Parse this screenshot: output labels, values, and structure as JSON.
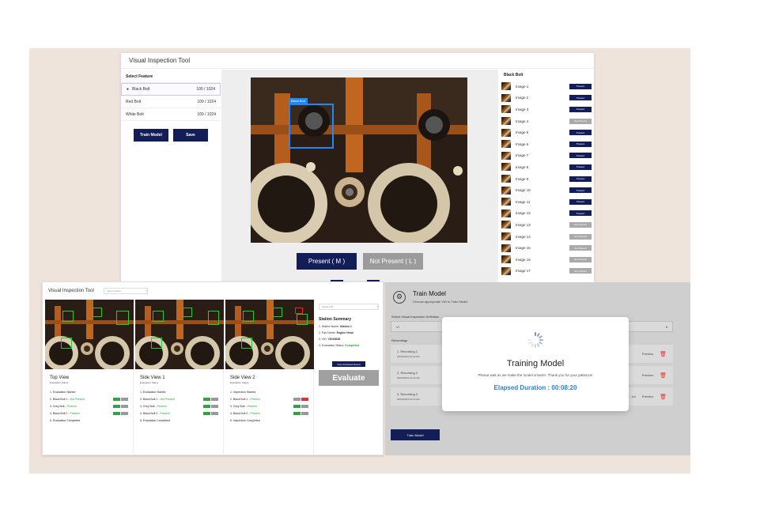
{
  "main": {
    "title": "Visual Inspection Tool",
    "features_header": "Select Feature",
    "features": [
      {
        "name": "Black Bolt",
        "count": "100 / 1024",
        "selected": true
      },
      {
        "name": "Red Bolt",
        "count": "100 / 1024"
      },
      {
        "name": "White Bolt",
        "count": "100 / 1024"
      }
    ],
    "train_label": "Train Model",
    "save_label": "Save",
    "bbox_tag": "Black Bolt",
    "present_label": "Present ( M )",
    "not_present_label": "Not Present ( L )",
    "images_header": "Black Bolt",
    "images": [
      {
        "name": "Image 1",
        "tag": "Present"
      },
      {
        "name": "Image 2",
        "tag": "Present"
      },
      {
        "name": "Image 3",
        "tag": "Present"
      },
      {
        "name": "Image 4",
        "tag": "Not Present"
      },
      {
        "name": "Image 5",
        "tag": "Present"
      },
      {
        "name": "Image 6",
        "tag": "Present"
      },
      {
        "name": "Image 7",
        "tag": "Present"
      },
      {
        "name": "Image 8",
        "tag": "Present"
      },
      {
        "name": "Image 9",
        "tag": "Present"
      },
      {
        "name": "Image 10",
        "tag": "Present"
      },
      {
        "name": "Image 11",
        "tag": "Present"
      },
      {
        "name": "Image 12",
        "tag": "Present"
      },
      {
        "name": "Image 13",
        "tag": "Not Present"
      },
      {
        "name": "Image 14",
        "tag": "Not Present"
      },
      {
        "name": "Image 15",
        "tag": "Not Present"
      },
      {
        "name": "Image 16",
        "tag": "Not Present"
      },
      {
        "name": "Image 17",
        "tag": "Not Present"
      }
    ]
  },
  "evaluation": {
    "title": "Visual Inspection Tool",
    "station_select": "Select Station",
    "views": [
      {
        "title": "Top View",
        "subtitle": "Evaluation Status",
        "rows": [
          {
            "text": "1. Evaluation Started"
          },
          {
            "text": "2. Black Bolt 1 - ",
            "status": "Not Present",
            "marks": [
              "g",
              "gr"
            ]
          },
          {
            "text": "3. Grey Bolt - ",
            "status": "Present",
            "marks": [
              "g",
              "gr"
            ]
          },
          {
            "text": "4. Black Bolt 2 - ",
            "status": "Present",
            "marks": [
              "g",
              "gr"
            ]
          },
          {
            "text": "5. Evaluation Completed"
          }
        ]
      },
      {
        "title": "Side View 1",
        "subtitle": "Evaluation Status",
        "rows": [
          {
            "text": "1. Evaluation Started"
          },
          {
            "text": "2. Black Bolt 1 - ",
            "status": "Not Present",
            "marks": [
              "g",
              "gr"
            ]
          },
          {
            "text": "3. Grey Bolt - ",
            "status": "Present",
            "marks": [
              "g",
              "gr"
            ]
          },
          {
            "text": "4. Black Bolt 2 - ",
            "status": "Present",
            "marks": [
              "g",
              "gr"
            ]
          },
          {
            "text": "5. Evaluation Completed"
          }
        ]
      },
      {
        "title": "Side View 2",
        "subtitle": "Evaluation Status",
        "rows": [
          {
            "text": "1. Inspection Started"
          },
          {
            "text": "2. Black Bolt 1 - ",
            "status": "Present",
            "marks": [
              "gr",
              "r"
            ]
          },
          {
            "text": "3. Grey Bolt - ",
            "status": "Present",
            "marks": [
              "g",
              "gr"
            ]
          },
          {
            "text": "4. Black Bolt 2 - ",
            "status": "Present",
            "marks": [
              "g",
              "gr"
            ]
          },
          {
            "text": "5. Inspection Completed"
          }
        ]
      }
    ],
    "summary_select": "Select VID",
    "summary_title": "Station Summary",
    "summary": [
      {
        "label": "1. Station Name: ",
        "value": "Station 1"
      },
      {
        "label": "2. Part Name: ",
        "value": "Engine Head"
      },
      {
        "label": "3. VID: ",
        "value": "VID45838"
      },
      {
        "label": "4. Evaluation Status: ",
        "value": "Completed",
        "ok": true
      }
    ],
    "view_predicted_label": "View Predicted Result",
    "evaluate_label": "Evaluate"
  },
  "train": {
    "title": "Train Model",
    "subtitle": "Choose appropriate VID to Train Model",
    "select_label": "Select Visual Inspection Definition",
    "select_value": "VI",
    "recordings_label": "Recordings",
    "recordings": [
      {
        "name": "1. Recording 1",
        "date": "18/03/2024",
        "time": "10:24 AM",
        "duration": "",
        "preview": "Preview"
      },
      {
        "name": "2. Recording 2",
        "date": "18/03/2024",
        "time": "10:24 AM",
        "duration": "",
        "preview": "Preview"
      },
      {
        "name": "3. Recording 3",
        "date": "18/03/2024",
        "time": "10:24 AM",
        "duration": "Duration : 1m",
        "preview": "Preview"
      }
    ],
    "train_button": "Train Model",
    "modal": {
      "title": "Training Model",
      "subtitle": "Please wait as we make the model smarter. Thank you for your patience!",
      "elapsed": "Elapsed Duration : 00:08:20"
    }
  },
  "colors": {
    "navy": "#131d58",
    "present_green": "#22aa33",
    "elapsed_blue": "#2f7fd1",
    "delete_red": "#e0332f",
    "bbox_blue": "#1f88ff"
  }
}
